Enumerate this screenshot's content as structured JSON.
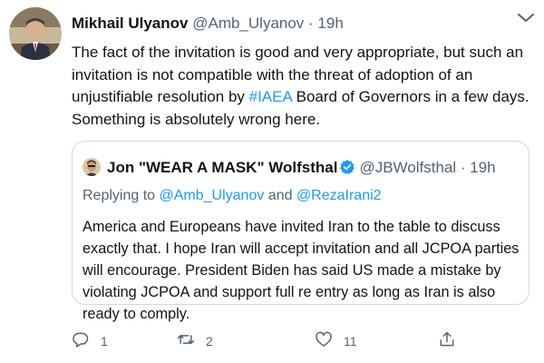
{
  "tweet": {
    "author_name": "Mikhail Ulyanov",
    "handle": "@Amb_Ulyanov",
    "separator": " · ",
    "time": "19h",
    "text_before_hashtag": "The fact of the invitation is good and very appropriate, but such an invitation is not compatible with the threat of adoption of an unjustifiable resolution by ",
    "hashtag": "#IAEA",
    "text_after_hashtag": " Board of Governors in a few days. Something is absolutely wrong here."
  },
  "quoted_tweet": {
    "author_name": "Jon \"WEAR A MASK\" Wolfsthal",
    "handle": "@JBWolfsthal",
    "separator": " · ",
    "time": "19h",
    "replying_prefix": "Replying to ",
    "mention_1": "@Amb_Ulyanov",
    "replying_and": " and ",
    "mention_2": "@RezaIrani2",
    "text": "America and Europeans have invited Iran to the table to discuss exactly that. I hope Iran will accept invitation and all JCPOA parties will encourage.  President Biden has said US made a mistake by violating JCPOA and support full re entry as long as Iran is also ready to comply."
  },
  "actions": {
    "reply_count": "1",
    "retweet_count": "2",
    "like_count": "11"
  },
  "colors": {
    "accent": "#1d9bf0",
    "text": "#0f1419",
    "secondary": "#536471",
    "border": "#cfd9de"
  },
  "icons": [
    "avatar",
    "more-icon",
    "verified-badge-icon",
    "reply-icon",
    "retweet-icon",
    "like-icon",
    "share-icon"
  ]
}
